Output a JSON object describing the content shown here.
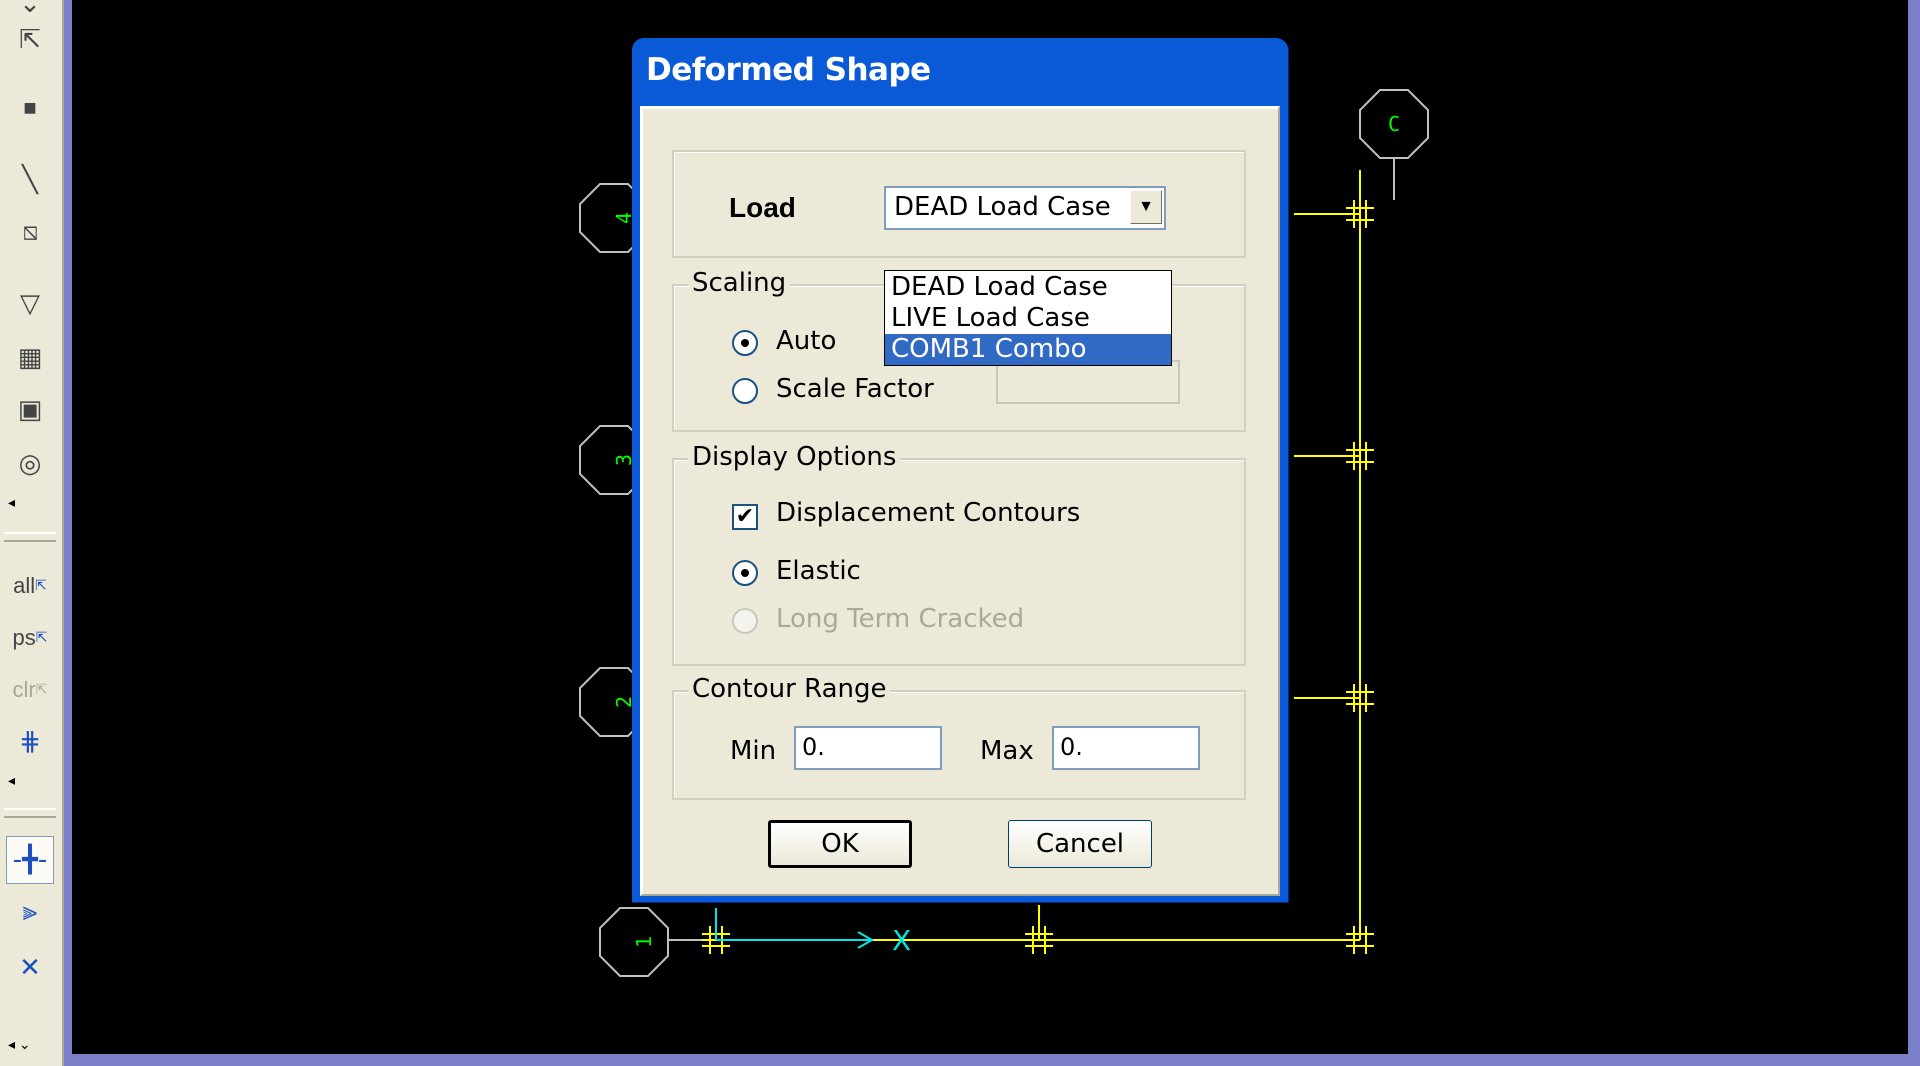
{
  "toolbar": {
    "buttons": [
      {
        "name": "pointer-icon",
        "glyph": "⇱"
      },
      {
        "name": "point-icon",
        "glyph": "·"
      },
      {
        "name": "draw-line-icon",
        "glyph": "╲"
      },
      {
        "name": "draw-line-box-icon",
        "glyph": "⧅"
      },
      {
        "name": "draw-area-icon",
        "glyph": "▽"
      },
      {
        "name": "draw-rectangle-icon",
        "glyph": "▦"
      },
      {
        "name": "quick-area-icon",
        "glyph": "▣"
      },
      {
        "name": "draw-circle-icon",
        "glyph": "◎"
      }
    ],
    "select_all_label": "all",
    "select_previous_label": "ps",
    "clear_selection_label": "clr"
  },
  "grid_bubbles": {
    "rows": [
      "4",
      "3",
      "2",
      "1"
    ],
    "columns": [
      "C"
    ]
  },
  "axis_label": "X",
  "dialog": {
    "title": "Deformed Shape",
    "load": {
      "label": "Load",
      "selected": "DEAD Load Case",
      "options": [
        "DEAD Load Case",
        "LIVE Load Case",
        "COMB1 Combo"
      ],
      "highlighted_option": "COMB1 Combo"
    },
    "scaling": {
      "label": "Scaling",
      "auto_label": "Auto",
      "scale_factor_label": "Scale Factor",
      "selected": "Auto",
      "scale_factor_value": ""
    },
    "display_options": {
      "label": "Display Options",
      "contours_label": "Displacement Contours",
      "contours_checked": true,
      "elastic_label": "Elastic",
      "long_term_label": "Long Term Cracked",
      "selected": "Elastic"
    },
    "contour_range": {
      "label": "Contour Range",
      "min_label": "Min",
      "min_value": "0.",
      "max_label": "Max",
      "max_value": "0."
    },
    "ok_label": "OK",
    "cancel_label": "Cancel"
  },
  "colors": {
    "grid_line": "#ffff00",
    "bubble_text": "#00ff00",
    "axis": "#00e5e5",
    "selection": "#316ac5"
  }
}
